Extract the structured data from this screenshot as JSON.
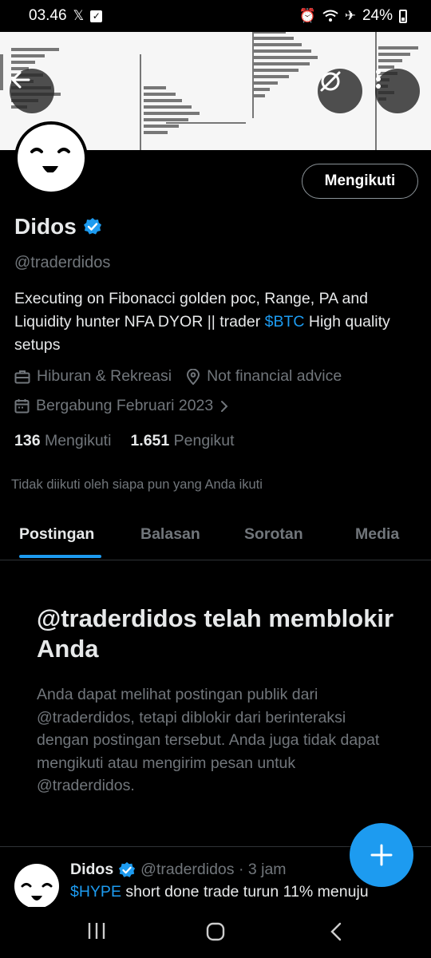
{
  "status_bar": {
    "time": "03.46",
    "battery": "24%"
  },
  "profile": {
    "display_name": "Didos",
    "handle": "@traderdidos",
    "follow_label": "Mengikuti",
    "bio_part1": "Executing on Fibonacci golden poc, Range, PA and Liquidity hunter NFA DYOR || trader ",
    "bio_cashtag": "$BTC",
    "bio_part2": " High quality setups",
    "category": "Hiburan & Rekreasi",
    "location": "Not financial advice",
    "joined": "Bergabung Februari 2023",
    "following_count": "136",
    "following_label": "Mengikuti",
    "followers_count": "1.651",
    "followers_label": "Pengikut",
    "not_followed_note": "Tidak diikuti oleh siapa pun yang Anda ikuti"
  },
  "tabs": [
    {
      "label": "Postingan",
      "active": true
    },
    {
      "label": "Balasan",
      "active": false
    },
    {
      "label": "Sorotan",
      "active": false
    },
    {
      "label": "Media",
      "active": false
    }
  ],
  "blocked": {
    "title": "@traderdidos telah memblokir Anda",
    "description": "Anda dapat melihat postingan publik dari @traderdidos, tetapi diblokir dari berinteraksi dengan postingan tersebut. Anda juga tidak dapat mengikuti atau mengirim pesan untuk @traderdidos."
  },
  "post": {
    "name": "Didos",
    "handle_time": "@traderdidos · 3 jam",
    "cashtag": "$HYPE",
    "text": " short done trade turun 11% menuju"
  },
  "colors": {
    "accent": "#1d9bf0",
    "background": "#000000",
    "text_primary": "#e7e9ea",
    "text_secondary": "#71767b"
  },
  "icons": [
    "back-arrow-icon",
    "grok-icon",
    "more-vertical-icon",
    "verified-badge-icon",
    "briefcase-icon",
    "location-pin-icon",
    "calendar-icon",
    "chevron-right-icon",
    "plus-icon",
    "recents-icon",
    "home-icon",
    "nav-back-icon"
  ]
}
